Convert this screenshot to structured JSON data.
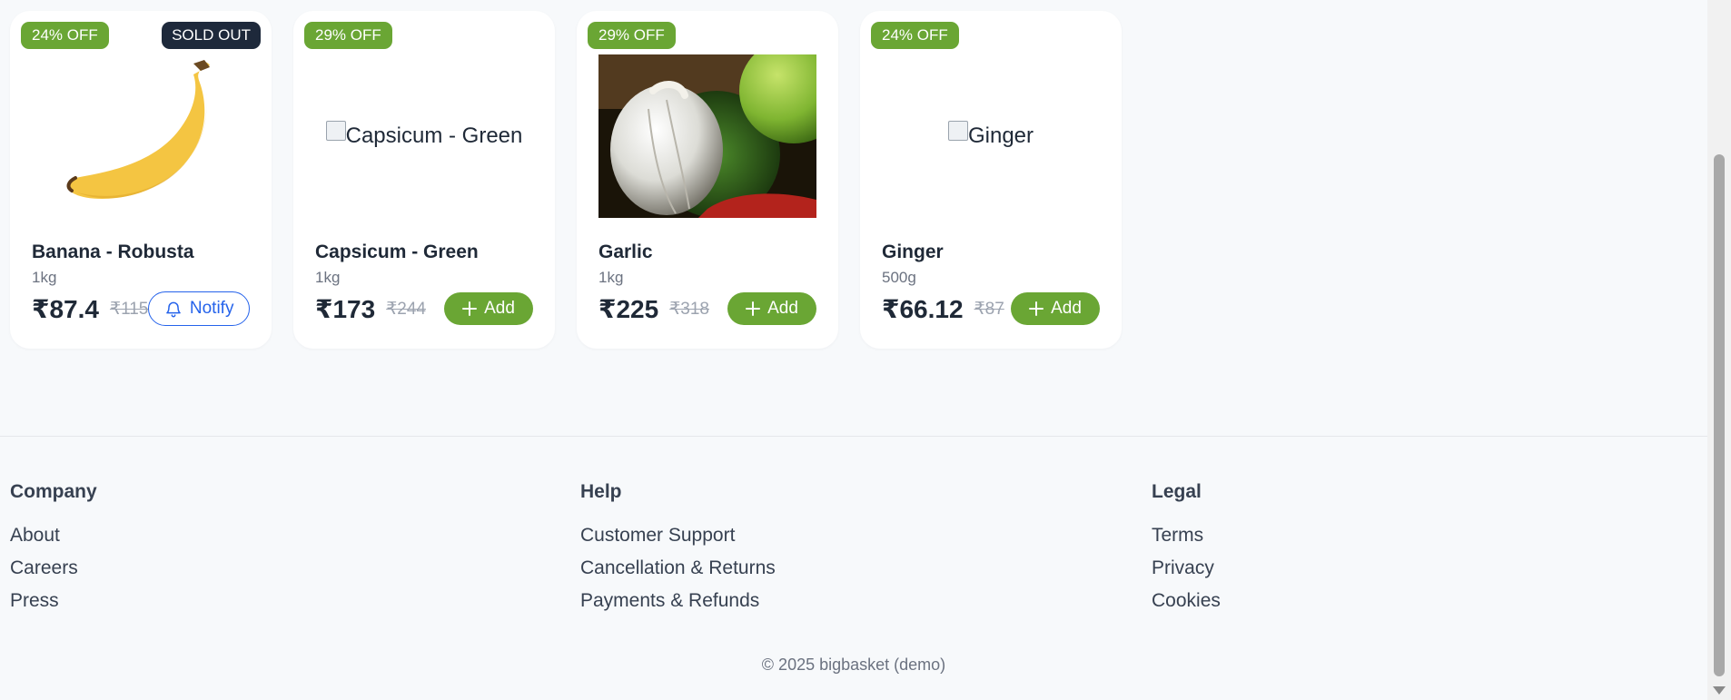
{
  "products": [
    {
      "discount": "24% OFF",
      "sold_out": "SOLD OUT",
      "name": "Banana - Robusta",
      "qty": "1kg",
      "price": "₹87.4",
      "mrp": "₹115",
      "action": "Notify"
    },
    {
      "discount": "29% OFF",
      "img_alt": "Capsicum - Green",
      "name": "Capsicum - Green",
      "qty": "1kg",
      "price": "₹173",
      "mrp": "₹244",
      "action": "Add"
    },
    {
      "discount": "29% OFF",
      "name": "Garlic",
      "qty": "1kg",
      "price": "₹225",
      "mrp": "₹318",
      "action": "Add"
    },
    {
      "discount": "24% OFF",
      "img_alt": "Ginger",
      "name": "Ginger",
      "qty": "500g",
      "price": "₹66.12",
      "mrp": "₹87",
      "action": "Add"
    }
  ],
  "footer": {
    "columns": [
      {
        "title": "Company",
        "links": [
          "About",
          "Careers",
          "Press"
        ]
      },
      {
        "title": "Help",
        "links": [
          "Customer Support",
          "Cancellation & Returns",
          "Payments & Refunds"
        ]
      },
      {
        "title": "Legal",
        "links": [
          "Terms",
          "Privacy",
          "Cookies"
        ]
      }
    ],
    "copyright": "© 2025 bigbasket (demo)"
  },
  "colors": {
    "accent_green": "#6aa634",
    "sold_out_badge": "#1e293b",
    "notify_blue": "#2563eb"
  },
  "icons": {
    "add": "plus-icon",
    "notify": "bell-icon"
  }
}
